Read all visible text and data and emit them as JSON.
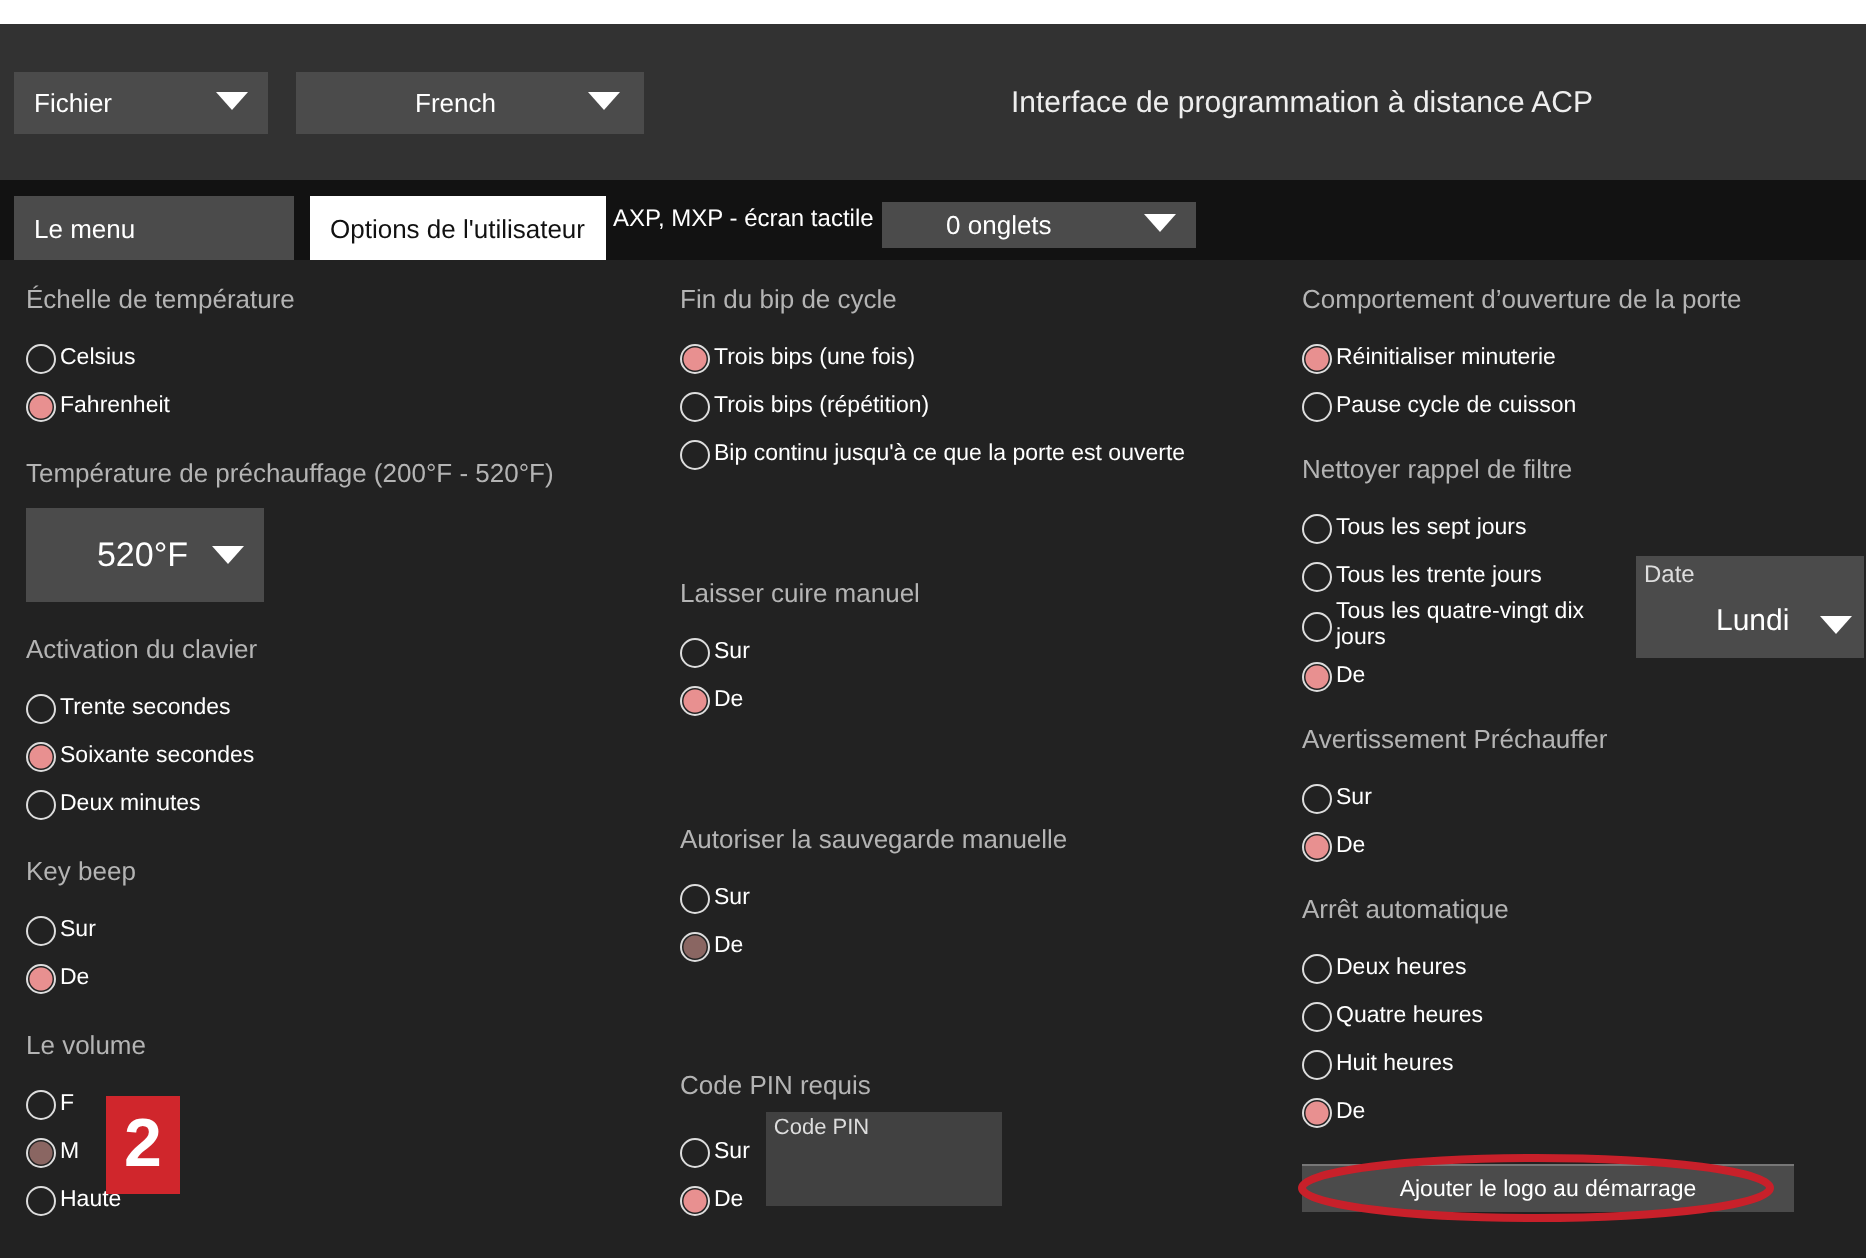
{
  "header": {
    "file_menu": "Fichier",
    "language": "French",
    "title": "Interface de programmation à distance ACP"
  },
  "tabs": [
    {
      "label": "Le menu",
      "selected": false
    },
    {
      "label": "Options de l'utilisateur",
      "selected": true
    }
  ],
  "device_label": "AXP, MXP - écran tactile",
  "tab_count_select": "0 onglets",
  "columns": [
    {
      "groups": [
        {
          "kind": "radios",
          "title": "Échelle de température",
          "muted": false,
          "options": [
            {
              "label": "Celsius",
              "selected": false
            },
            {
              "label": "Fahrenheit",
              "selected": true
            }
          ]
        },
        {
          "kind": "select",
          "title": "Température de préchauffage (200°F - 520°F)",
          "value": "520°F"
        },
        {
          "kind": "radios",
          "title": "Activation du clavier",
          "muted": false,
          "options": [
            {
              "label": "Trente secondes",
              "selected": false
            },
            {
              "label": "Soixante secondes",
              "selected": true
            },
            {
              "label": "Deux minutes",
              "selected": false
            }
          ]
        },
        {
          "kind": "radios",
          "title": "Key beep",
          "muted": false,
          "options": [
            {
              "label": "Sur",
              "selected": false
            },
            {
              "label": "De",
              "selected": true
            }
          ]
        },
        {
          "kind": "radios",
          "title": "Le volume",
          "muted": true,
          "options": [
            {
              "label": "F",
              "selected": false
            },
            {
              "label": "M",
              "selected": true
            },
            {
              "label": "Haute",
              "selected": false
            }
          ]
        }
      ]
    },
    {
      "groups": [
        {
          "kind": "radios",
          "title": "Fin du bip de cycle",
          "muted": false,
          "options": [
            {
              "label": "Trois bips (une fois)",
              "selected": true
            },
            {
              "label": "Trois bips (répétition)",
              "selected": false
            },
            {
              "label": "Bip continu jusqu'à ce que la porte est ouverte",
              "selected": false
            }
          ]
        },
        {
          "kind": "radios",
          "title": "Laisser cuire manuel",
          "muted": false,
          "options": [
            {
              "label": "Sur",
              "selected": false
            },
            {
              "label": "De",
              "selected": true
            }
          ]
        },
        {
          "kind": "radios",
          "title": "Autoriser la sauvegarde manuelle",
          "muted": true,
          "options": [
            {
              "label": "Sur",
              "selected": false
            },
            {
              "label": "De",
              "selected": true
            }
          ]
        },
        {
          "kind": "pin",
          "title": "Code PIN requis",
          "muted": false,
          "placeholder": "Code PIN",
          "options": [
            {
              "label": "Sur",
              "selected": false
            },
            {
              "label": "De",
              "selected": true
            }
          ]
        }
      ]
    },
    {
      "groups": [
        {
          "kind": "radios",
          "title": "Comportement d’ouverture de la porte",
          "muted": false,
          "options": [
            {
              "label": "Réinitialiser minuterie",
              "selected": true
            },
            {
              "label": "Pause cycle de cuisson",
              "selected": false
            }
          ]
        },
        {
          "kind": "radios",
          "title": "Nettoyer rappel de filtre",
          "muted": false,
          "date_label": "Date",
          "date_value": "Lundi",
          "options": [
            {
              "label": "Tous les sept jours",
              "selected": false
            },
            {
              "label": "Tous les trente jours",
              "selected": false
            },
            {
              "label": "Tous les quatre-vingt dix jours",
              "selected": false
            },
            {
              "label": "De",
              "selected": true
            }
          ]
        },
        {
          "kind": "radios",
          "title": "Avertissement Préchauffer",
          "muted": false,
          "options": [
            {
              "label": "Sur",
              "selected": false
            },
            {
              "label": "De",
              "selected": true
            }
          ]
        },
        {
          "kind": "radios",
          "title": "Arrêt automatique",
          "muted": false,
          "options": [
            {
              "label": "Deux heures",
              "selected": false
            },
            {
              "label": "Quatre heures",
              "selected": false
            },
            {
              "label": "Huit heures",
              "selected": false
            },
            {
              "label": "De",
              "selected": true
            }
          ]
        },
        {
          "kind": "button",
          "label": "Ajouter le logo au démarrage",
          "highlighted": true
        }
      ]
    }
  ],
  "callout_badge": "2"
}
